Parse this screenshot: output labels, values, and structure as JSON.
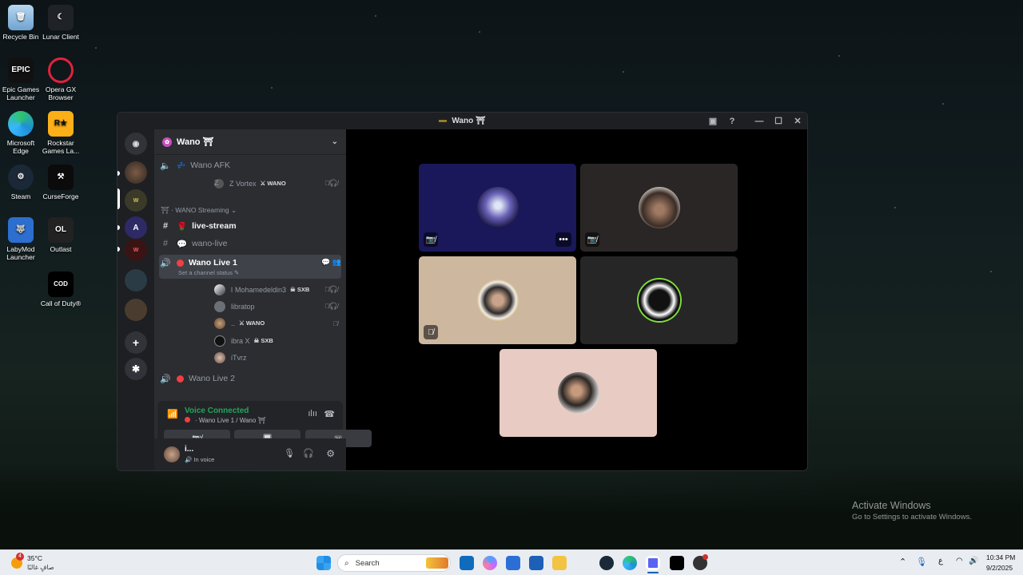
{
  "desktop": {
    "icons": [
      {
        "label": "Recycle Bin"
      },
      {
        "label": "Lunar Client"
      },
      {
        "label": "Epic Games Launcher"
      },
      {
        "label": "Opera GX Browser"
      },
      {
        "label": "Microsoft Edge"
      },
      {
        "label": "Rockstar Games La..."
      },
      {
        "label": "Steam"
      },
      {
        "label": "CurseForge"
      },
      {
        "label": "LabyMod Launcher"
      },
      {
        "label": "Outlast"
      },
      {
        "label": "Call of Duty®"
      }
    ],
    "activate": {
      "title": "Activate Windows",
      "subtitle": "Go to Settings to activate Windows."
    }
  },
  "window": {
    "title": "Wano ⛩",
    "server_name": "Wano ⛩",
    "channels": {
      "afk": "Wano AFK",
      "afk_user": {
        "name": "Z Vortex",
        "tag": "WANO"
      },
      "category": "WANO Streaming",
      "live_stream": "live-stream",
      "wano_live": "wano-live",
      "active_voice": "Wano Live 1",
      "channel_status": "Set a channel status",
      "voice_users": [
        {
          "name": "Mohamedeldin3",
          "tag": "SXB",
          "prefix": "l"
        },
        {
          "name": "libratop",
          "tag": ""
        },
        {
          "name": "..",
          "tag": "WANO"
        },
        {
          "name": "ibra X",
          "tag": "SXB"
        },
        {
          "name": "iTvrz",
          "tag": ""
        }
      ],
      "next_voice": "Wano Live 2"
    },
    "voice_panel": {
      "status": "Voice Connected",
      "location": "Wano Live 1 / Wano ⛩"
    },
    "user_panel": {
      "name": "i...",
      "status": "In voice"
    }
  },
  "taskbar": {
    "weather_temp": "35°C",
    "weather_desc": "صافٍ غالبًا",
    "weather_badge": "4",
    "search_placeholder": "Search",
    "lang": "ع",
    "time": "10:34 PM",
    "date": "9/2/2025"
  }
}
